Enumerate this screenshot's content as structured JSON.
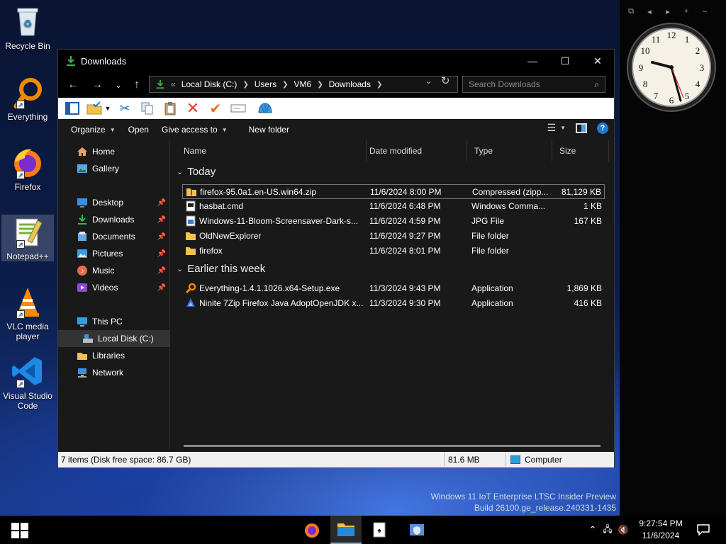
{
  "desktop": {
    "icons": [
      {
        "label": "Recycle Bin"
      },
      {
        "label": "Everything"
      },
      {
        "label": "Firefox"
      },
      {
        "label": "Notepad++"
      },
      {
        "label": "VLC media player"
      },
      {
        "label": "Visual Studio Code"
      }
    ],
    "watermark": {
      "line1": "Windows 11 IoT Enterprise LTSC Insider Preview",
      "line2": "Build 26100.ge_release.240331-1435"
    }
  },
  "window": {
    "title": "Downloads",
    "controls": {
      "minimize": "—",
      "maximize": "☐",
      "close": "✕"
    }
  },
  "address": {
    "overflow": "«",
    "crumbs": [
      "Local Disk (C:)",
      "Users",
      "VM6",
      "Downloads"
    ],
    "search_placeholder": "Search Downloads"
  },
  "commands": {
    "organize": "Organize",
    "open": "Open",
    "give_access": "Give access to",
    "new_folder": "New folder"
  },
  "navpane": {
    "items": [
      {
        "label": "Home",
        "icon": "home-icon"
      },
      {
        "label": "Gallery",
        "icon": "gallery-icon"
      },
      {
        "label": "Desktop",
        "icon": "desktop-icon",
        "pinned": true
      },
      {
        "label": "Downloads",
        "icon": "download-icon",
        "pinned": true
      },
      {
        "label": "Documents",
        "icon": "documents-icon",
        "pinned": true
      },
      {
        "label": "Pictures",
        "icon": "pictures-icon",
        "pinned": true
      },
      {
        "label": "Music",
        "icon": "music-icon",
        "pinned": true
      },
      {
        "label": "Videos",
        "icon": "videos-icon",
        "pinned": true
      },
      {
        "label": "This PC",
        "icon": "pc-icon"
      },
      {
        "label": "Local Disk (C:)",
        "icon": "drive-icon",
        "selected": true
      },
      {
        "label": "Libraries",
        "icon": "libraries-icon"
      },
      {
        "label": "Network",
        "icon": "network-icon"
      }
    ]
  },
  "columns": [
    "Name",
    "Date modified",
    "Type",
    "Size"
  ],
  "groups": [
    {
      "label": "Today",
      "files": [
        {
          "name": "firefox-95.0a1.en-US.win64.zip",
          "date": "11/6/2024 8:00 PM",
          "type": "Compressed (zipp...",
          "size": "81,129 KB",
          "icon": "zip-folder-icon"
        },
        {
          "name": "hasbat.cmd",
          "date": "11/6/2024 6:48 PM",
          "type": "Windows Comma...",
          "size": "1 KB",
          "icon": "cmd-file-icon"
        },
        {
          "name": "Windows-11-Bloom-Screensaver-Dark-s...",
          "date": "11/6/2024 4:59 PM",
          "type": "JPG File",
          "size": "167 KB",
          "icon": "image-file-icon"
        },
        {
          "name": "OldNewExplorer",
          "date": "11/6/2024 9:27 PM",
          "type": "File folder",
          "size": "",
          "icon": "folder-icon"
        },
        {
          "name": "firefox",
          "date": "11/6/2024 8:01 PM",
          "type": "File folder",
          "size": "",
          "icon": "folder-icon"
        }
      ]
    },
    {
      "label": "Earlier this week",
      "files": [
        {
          "name": "Everything-1.4.1.1026.x64-Setup.exe",
          "date": "11/3/2024 9:43 PM",
          "type": "Application",
          "size": "1,869 KB",
          "icon": "everything-icon"
        },
        {
          "name": "Ninite 7Zip Firefox Java AdoptOpenJDK x...",
          "date": "11/3/2024 9:30 PM",
          "type": "Application",
          "size": "416 KB",
          "icon": "ninite-icon"
        }
      ]
    }
  ],
  "status": {
    "items": "7 items (Disk free space: 86.7 GB)",
    "size": "81.6 MB",
    "location": "Computer"
  },
  "taskbar": {
    "time": "9:27:54 PM",
    "date": "11/6/2024"
  },
  "colors": {
    "accent": "#0a64c8",
    "folder": "#f2c14e",
    "window_bg": "#191919"
  }
}
